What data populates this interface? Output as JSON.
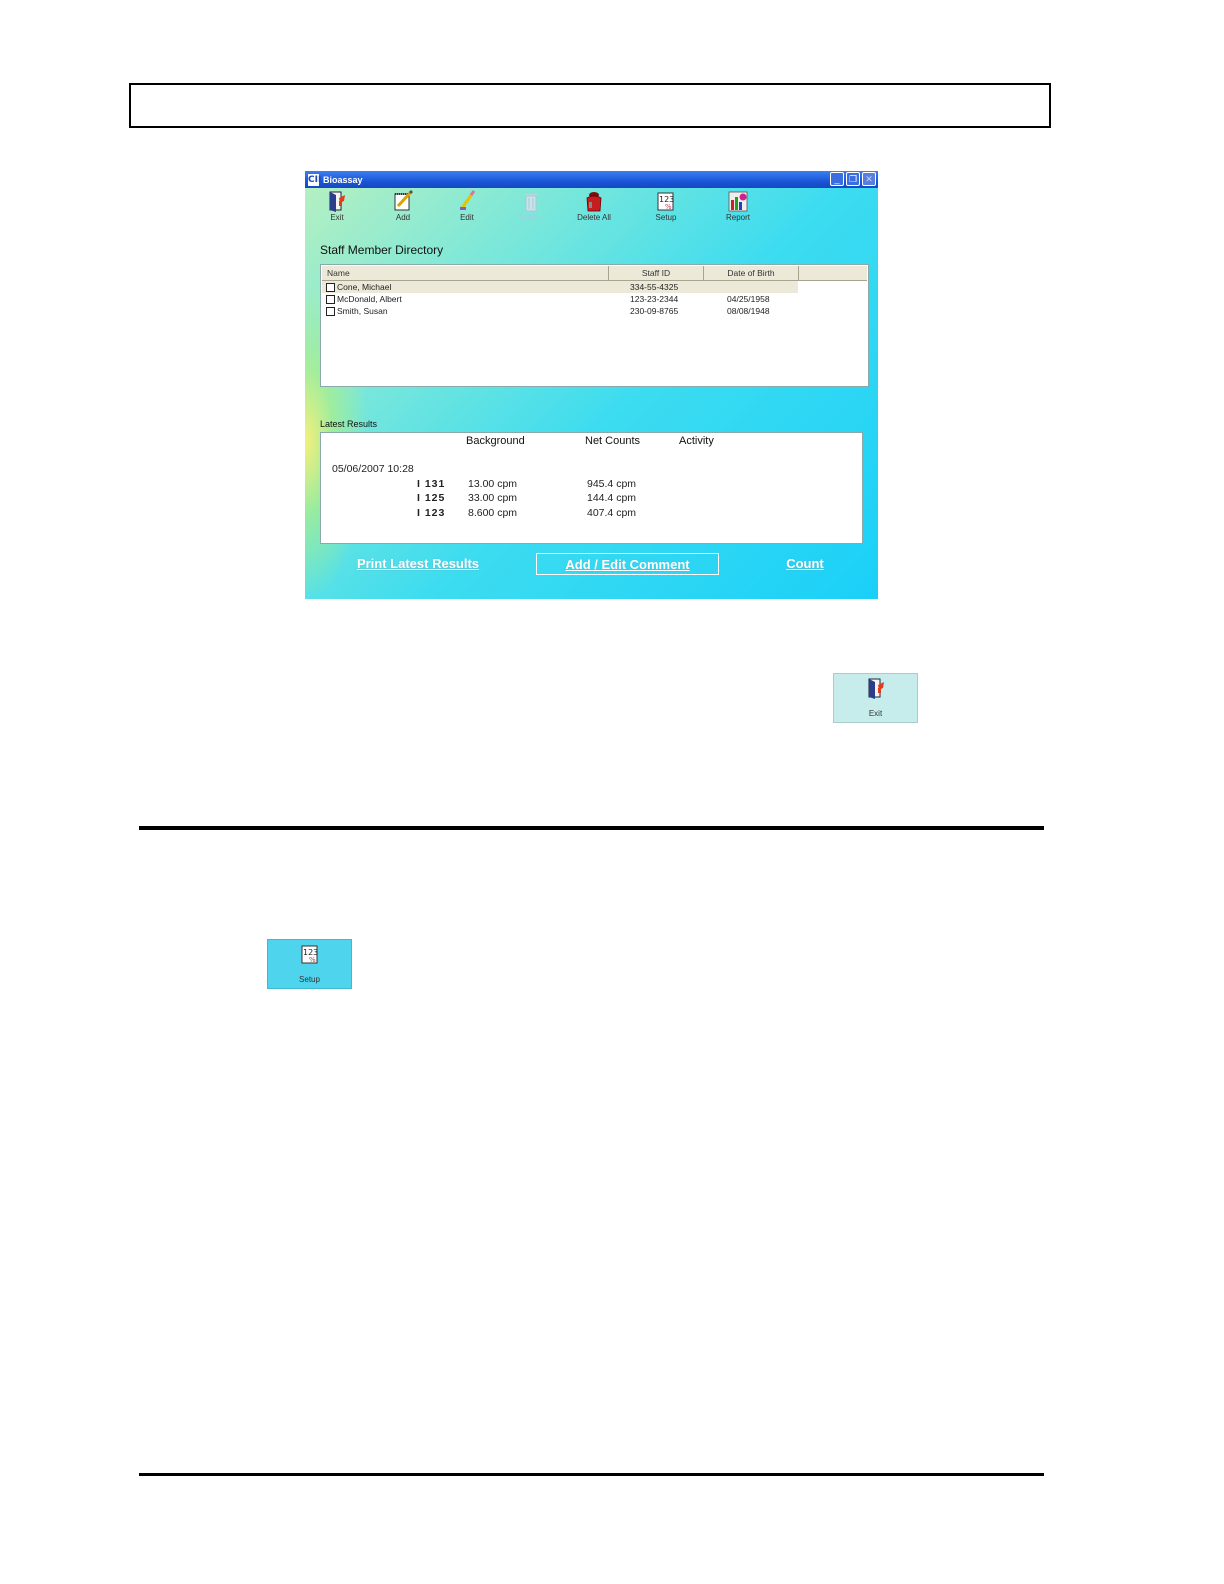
{
  "window": {
    "title": "Bioassay",
    "logo": "CII"
  },
  "toolbar": {
    "items": [
      {
        "label": "Exit",
        "icon": "exit-door-icon",
        "enabled": true
      },
      {
        "label": "Add",
        "icon": "notepad-pencil-icon",
        "enabled": true
      },
      {
        "label": "Edit",
        "icon": "eraser-pencil-icon",
        "enabled": true
      },
      {
        "label": "Delete",
        "icon": "trash-can-icon",
        "enabled": false
      },
      {
        "label": "Delete All",
        "icon": "trash-bag-icon",
        "enabled": true
      },
      {
        "label": "Setup",
        "icon": "setup-123-icon",
        "enabled": true
      },
      {
        "label": "Report",
        "icon": "report-chart-icon",
        "enabled": true
      }
    ]
  },
  "directory": {
    "title": "Staff Member Directory",
    "columns": [
      "Name",
      "Staff ID",
      "Date of Birth"
    ],
    "rows": [
      {
        "name": "Cone, Michael",
        "staff_id": "334-55-4325",
        "dob": "",
        "selected": true
      },
      {
        "name": "McDonald, Albert",
        "staff_id": "123-23-2344",
        "dob": "04/25/1958",
        "selected": false
      },
      {
        "name": "Smith, Susan",
        "staff_id": "230-09-8765",
        "dob": "08/08/1948",
        "selected": false
      }
    ]
  },
  "results": {
    "title": "Latest Results",
    "headers": {
      "background": "Background",
      "net_counts": "Net Counts",
      "activity": "Activity"
    },
    "timestamp": "05/06/2007  10:28",
    "rows": [
      {
        "isotope": "I 131",
        "background": "13.00 cpm",
        "net_counts": "945.4 cpm"
      },
      {
        "isotope": "I 125",
        "background": "33.00 cpm",
        "net_counts": "144.4 cpm"
      },
      {
        "isotope": "I 123",
        "background": "8.600 cpm",
        "net_counts": "407.4 cpm"
      }
    ]
  },
  "buttons": {
    "print": "Print Latest Results",
    "comment": "Add / Edit Comment",
    "count": "Count"
  },
  "snippets": {
    "exit_label": "Exit",
    "setup_label": "Setup"
  },
  "colors": {
    "titlebar": "#1a56d8",
    "window_gradient_end": "#1ad0f8",
    "exit_snippet_bg": "#c6ecec",
    "setup_snippet_bg": "#4fd4ee"
  }
}
